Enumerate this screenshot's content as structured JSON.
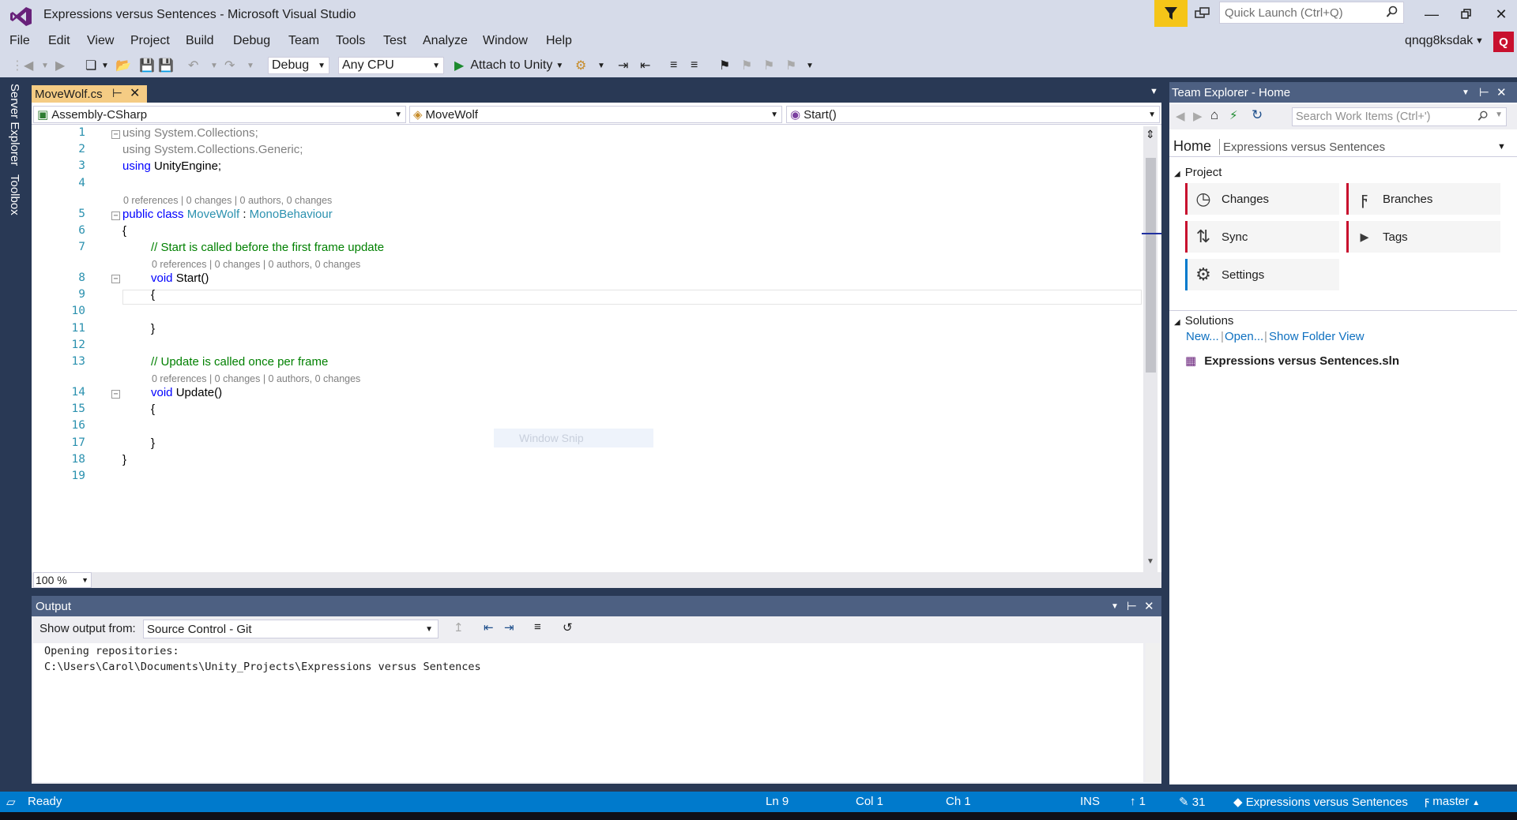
{
  "window": {
    "title": "Expressions versus Sentences - Microsoft Visual Studio",
    "quick_launch_placeholder": "Quick Launch (Ctrl+Q)",
    "account": "qnqg8ksdak"
  },
  "menu": [
    "File",
    "Edit",
    "View",
    "Project",
    "Build",
    "Debug",
    "Team",
    "Tools",
    "Test",
    "Analyze",
    "Window",
    "Help"
  ],
  "toolbar": {
    "configuration": "Debug",
    "platform": "Any CPU",
    "attach_label": "Attach to Unity"
  },
  "left_tabs": [
    "Server Explorer",
    "Toolbox"
  ],
  "editor": {
    "tab_name": "MoveWolf.cs",
    "nav_project": "Assembly-CSharp",
    "nav_class": "MoveWolf",
    "nav_member": "Start()",
    "zoom": "100 %",
    "line_numbers": [
      "1",
      "2",
      "3",
      "4",
      "5",
      "6",
      "7",
      "8",
      "9",
      "10",
      "11",
      "12",
      "13",
      "14",
      "15",
      "16",
      "17",
      "18",
      "19"
    ],
    "code": {
      "l1": "System.Collections;",
      "l2": "System.Collections.Generic;",
      "l3": "UnityEngine;",
      "using": "using",
      "public": "public",
      "class": "class",
      "class_name": "MoveWolf",
      "colon": " : ",
      "base": "MonoBehaviour",
      "open": "{",
      "close": "}",
      "comment_start": "// Start is called before the first frame update",
      "void": "void",
      "start": "Start()",
      "comment_update": "// Update is called once per frame",
      "update": "Update()"
    },
    "lens_class": "0 references | 0 changes | 0 authors, 0 changes",
    "lens_start": "0 references | 0 changes | 0 authors, 0 changes",
    "lens_update": "0 references | 0 changes | 0 authors, 0 changes",
    "snip_overlay": "Window Snip"
  },
  "output": {
    "title": "Output",
    "show_from_label": "Show output from:",
    "source": "Source Control - Git",
    "line1": "Opening repositories:",
    "line2": "C:\\Users\\Carol\\Documents\\Unity_Projects\\Expressions versus Sentences"
  },
  "team_explorer": {
    "title": "Team Explorer - Home",
    "search_placeholder": "Search Work Items (Ctrl+')",
    "home": "Home",
    "subtitle": "Expressions versus Sentences",
    "project_section": "Project",
    "tiles": [
      "Changes",
      "Branches",
      "Sync",
      "Tags",
      "Settings"
    ],
    "solutions_section": "Solutions",
    "links": [
      "New...",
      "Open...",
      "Show Folder View"
    ],
    "solution_file": "Expressions versus Sentences.sln"
  },
  "status": {
    "ready": "Ready",
    "ln": "Ln 9",
    "col": "Col 1",
    "ch": "Ch 1",
    "ins": "INS",
    "up_count": "1",
    "edit_count": "31",
    "repo": "Expressions versus Sentences",
    "branch": "master"
  },
  "colors": {
    "chrome": "#d6dbe9",
    "dark": "#293955",
    "status": "#007acc",
    "tab_active": "#f5cc84",
    "keyword": "#0000ff",
    "type": "#2b91af",
    "comment": "#008000",
    "tile_red": "#c8102e",
    "tile_blue": "#007acc"
  }
}
